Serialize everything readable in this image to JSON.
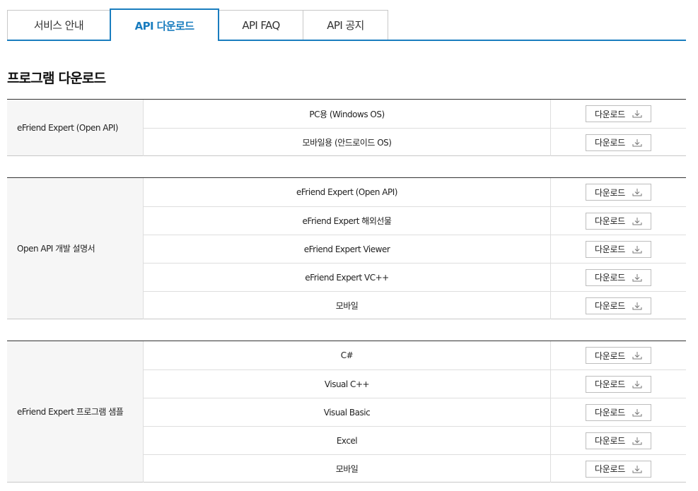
{
  "tabs": [
    {
      "label": "서비스 안내",
      "active": false
    },
    {
      "label": "API 다운로드",
      "active": true
    },
    {
      "label": "API FAQ",
      "active": false
    },
    {
      "label": "API 공지",
      "active": false
    }
  ],
  "section_title": "프로그램 다운로드",
  "download_label": "다운로드",
  "icon": "download-icon",
  "accent_color": "#1a7dbf",
  "groups": [
    {
      "label": "eFriend Expert (Open API)",
      "items": [
        "PC용 (Windows OS)",
        "모바일용 (안드로이드 OS)"
      ]
    },
    {
      "label": "Open API 개발 설명서",
      "items": [
        "eFriend Expert (Open API)",
        "eFriend Expert 해외선물",
        "eFriend Expert Viewer",
        "eFriend Expert VC++",
        "모바일"
      ]
    },
    {
      "label": "eFriend Expert 프로그램 샘플",
      "items": [
        "C#",
        "Visual C++",
        "Visual Basic",
        "Excel",
        "모바일"
      ]
    }
  ]
}
